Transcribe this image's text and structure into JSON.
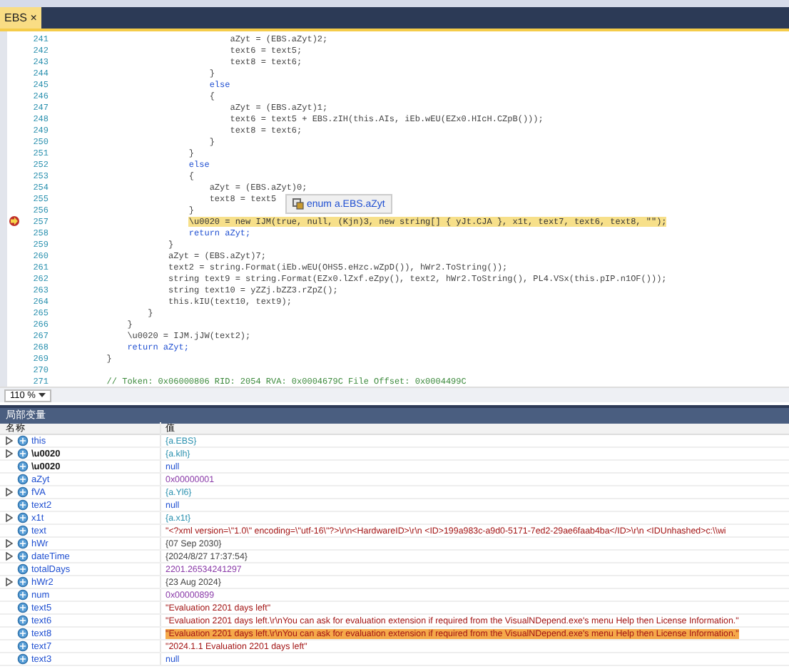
{
  "tab": {
    "label": "EBS",
    "close": "×",
    "selected": true
  },
  "code_lines": [
    {
      "num": "241",
      "kind": "code",
      "code": "                                aZyt = (EBS.aZyt)2;"
    },
    {
      "num": "242",
      "kind": "code",
      "code": "                                text6 = text5;"
    },
    {
      "num": "243",
      "kind": "code",
      "code": "                                text8 = text6;"
    },
    {
      "num": "244",
      "kind": "code",
      "code": "                            }"
    },
    {
      "num": "245",
      "kind": "keyword",
      "code": "                            else"
    },
    {
      "num": "246",
      "kind": "code",
      "code": "                            {"
    },
    {
      "num": "247",
      "kind": "code",
      "code": "                                aZyt = (EBS.aZyt)1;"
    },
    {
      "num": "248",
      "kind": "code",
      "code": "                                text6 = text5 + EBS.zIH(this.AIs, iEb.wEU(EZx0.HIcH.CZpB()));"
    },
    {
      "num": "249",
      "kind": "code",
      "code": "                                text8 = text6;"
    },
    {
      "num": "250",
      "kind": "code",
      "code": "                            }"
    },
    {
      "num": "251",
      "kind": "code",
      "code": "                        }"
    },
    {
      "num": "252",
      "kind": "keyword",
      "code": "                        else"
    },
    {
      "num": "253",
      "kind": "code",
      "code": "                        {"
    },
    {
      "num": "254",
      "kind": "code",
      "code": "                            aZyt = (EBS.aZyt)0;"
    },
    {
      "num": "255",
      "kind": "code",
      "code": "                            text8 = text5"
    },
    {
      "num": "256",
      "kind": "code",
      "code": "                        }"
    },
    {
      "num": "257",
      "kind": "current",
      "code": "                        \\u0020 = new IJM(true, null, (Kjn)3, new string[] { yJt.CJA }, x1t, text7, text6, text8, \"\");"
    },
    {
      "num": "258",
      "kind": "keyword",
      "code": "                        return aZyt;"
    },
    {
      "num": "259",
      "kind": "code",
      "code": "                    }"
    },
    {
      "num": "260",
      "kind": "code",
      "code": "                    aZyt = (EBS.aZyt)7;"
    },
    {
      "num": "261",
      "kind": "code",
      "code": "                    text2 = string.Format(iEb.wEU(OHS5.eHzc.wZpD()), hWr2.ToString());"
    },
    {
      "num": "262",
      "kind": "code",
      "code": "                    string text9 = string.Format(EZx0.lZxf.eZpy(), text2, hWr2.ToString(), PL4.VSx(this.pIP.n1OF()));"
    },
    {
      "num": "263",
      "kind": "code",
      "code": "                    string text10 = yZZj.bZZ3.rZpZ();"
    },
    {
      "num": "264",
      "kind": "code",
      "code": "                    this.kIU(text10, text9);"
    },
    {
      "num": "265",
      "kind": "code",
      "code": "                }"
    },
    {
      "num": "266",
      "kind": "code",
      "code": "            }"
    },
    {
      "num": "267",
      "kind": "code",
      "code": "            \\u0020 = IJM.jJW(text2);"
    },
    {
      "num": "268",
      "kind": "keyword",
      "code": "            return aZyt;"
    },
    {
      "num": "269",
      "kind": "code",
      "code": "        }"
    },
    {
      "num": "270",
      "kind": "code"
    },
    {
      "num": "271",
      "kind": "comment",
      "code": "        // Token: 0x06000806 RID: 2054 RVA: 0x0004679C File Offset: 0x0004499C"
    }
  ],
  "tooltip": {
    "text": "enum a.EBS.aZyt"
  },
  "zoom": {
    "value": "110 %"
  },
  "locals": {
    "title": "局部变量",
    "columns": [
      "名称",
      "值"
    ],
    "rows": [
      {
        "name": "this",
        "value": "{a.EBS}",
        "kind": "object",
        "has_children": true,
        "changed": false,
        "selected": false
      },
      {
        "name": "\\u0020",
        "value": "{a.klh}",
        "kind": "object",
        "has_children": true,
        "changed": true,
        "selected": false
      },
      {
        "name": "\\u0020",
        "value": "null",
        "kind": "null",
        "has_children": false,
        "changed": true,
        "selected": false
      },
      {
        "name": "aZyt",
        "value": "0x00000001",
        "kind": "number",
        "has_children": false,
        "changed": false,
        "selected": false
      },
      {
        "name": "fVA",
        "value": "{a.Yl6}",
        "kind": "object",
        "has_children": true,
        "changed": false,
        "selected": false
      },
      {
        "name": "text2",
        "value": "null",
        "kind": "null",
        "has_children": false,
        "changed": false,
        "selected": false
      },
      {
        "name": "x1t",
        "value": "{a.x1t}",
        "kind": "object",
        "has_children": true,
        "changed": false,
        "selected": false
      },
      {
        "name": "text",
        "value": "\"<?xml version=\\\"1.0\\\" encoding=\\\"utf-16\\\"?>\\r\\n<HardwareID>\\r\\n  <ID>199a983c-a9d0-5171-7ed2-29ae6faab4ba</ID>\\r\\n  <IDUnhashed>c:\\\\wi",
        "kind": "string",
        "has_children": false,
        "changed": false,
        "selected": false
      },
      {
        "name": "hWr",
        "value": "{07 Sep 2030}",
        "kind": "date",
        "has_children": true,
        "changed": false,
        "selected": false
      },
      {
        "name": "dateTime",
        "value": "{2024/8/27 17:37:54}",
        "kind": "date",
        "has_children": true,
        "changed": false,
        "selected": false
      },
      {
        "name": "totalDays",
        "value": "2201.26534241297",
        "kind": "number",
        "has_children": false,
        "changed": false,
        "selected": false
      },
      {
        "name": "hWr2",
        "value": "{23 Aug 2024}",
        "kind": "date",
        "has_children": true,
        "changed": false,
        "selected": false
      },
      {
        "name": "num",
        "value": "0x00000899",
        "kind": "number",
        "has_children": false,
        "changed": false,
        "selected": false
      },
      {
        "name": "text5",
        "value": "\"Evaluation 2201 days left\"",
        "kind": "string",
        "has_children": false,
        "changed": false,
        "selected": false
      },
      {
        "name": "text6",
        "value": "\"Evaluation 2201 days left.\\r\\nYou can ask for evaluation extension if required from the VisualNDepend.exe's menu Help then License Information.\"",
        "kind": "string",
        "has_children": false,
        "changed": false,
        "selected": false
      },
      {
        "name": "text8",
        "value": "\"Evaluation 2201 days left.\\r\\nYou can ask for evaluation extension if required from the VisualNDepend.exe's menu Help then License Information.\"",
        "kind": "string",
        "has_children": false,
        "changed": false,
        "selected": true
      },
      {
        "name": "text7",
        "value": "\"2024.1.1    Evaluation 2201 days left\"",
        "kind": "string",
        "has_children": false,
        "changed": false,
        "selected": false
      },
      {
        "name": "text3",
        "value": "null",
        "kind": "null",
        "has_children": false,
        "changed": false,
        "selected": false
      }
    ]
  }
}
